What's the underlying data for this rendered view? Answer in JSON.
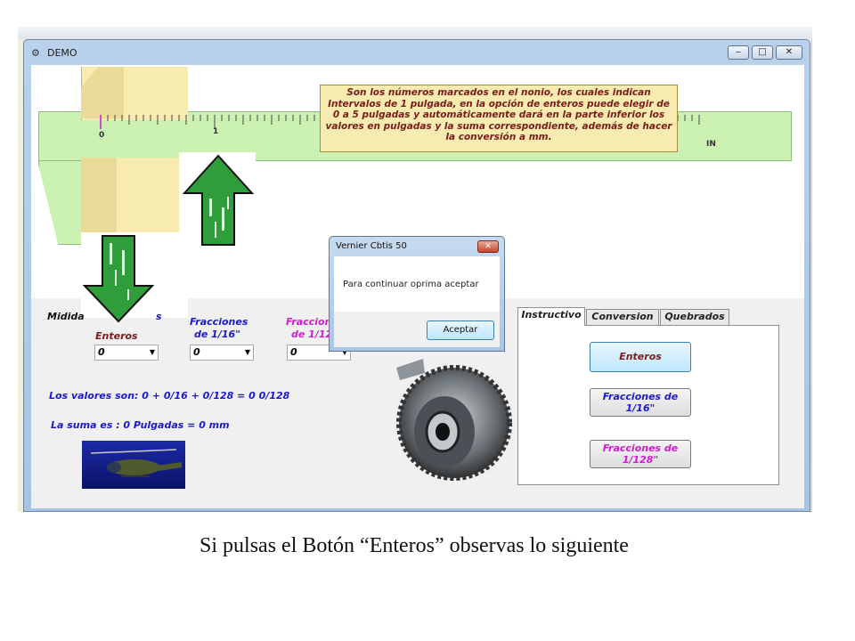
{
  "window": {
    "title": "DEMO",
    "min": "‒",
    "max": "□",
    "close": "✕"
  },
  "ruler": {
    "zero": "0",
    "one": "1",
    "unit": "IN"
  },
  "info": "Son los números marcados en el nonio, los cuales indican Intervalos de 1 pulgada, en la opción de enteros puede elegir de 0 a 5 pulgadas y automáticamente dará en la parte inferior los valores en pulgadas y la suma correspondiente, además de hacer la conversión a mm.",
  "labels": {
    "midida": "Midida",
    "s": "s",
    "enteros": "Enteros",
    "fracciones16_line1": "Fracciones",
    "fracciones16_line2": "de 1/16\"",
    "fracciones128_line1": "Fraccion",
    "fracciones128_line2": "de 1/12"
  },
  "combos": {
    "enteros": "0",
    "fracciones16": "0",
    "fracciones128": "0"
  },
  "valores": "Los valores son: 0 + 0/16 + 0/128 = 0   0/128",
  "suma": "La suma es : 0 Pulgadas = 0 mm",
  "tabs": [
    "Instructivo",
    "Conversion",
    "Quebrados"
  ],
  "buttons": {
    "enteros": "Enteros",
    "fracciones16": "Fracciones de 1/16\"",
    "fracciones128": "Fracciones de 1/128\""
  },
  "colors": {
    "blue": "#1a1acc",
    "magenta": "#d21ad2",
    "maroon": "#7a1c1c"
  },
  "dialog": {
    "title": "Vernier Cbtis 50",
    "message": "Para continuar oprima aceptar",
    "ok": "Aceptar",
    "close": "✕"
  },
  "caption": "Si pulsas el Botón “Enteros” observas lo siguiente"
}
